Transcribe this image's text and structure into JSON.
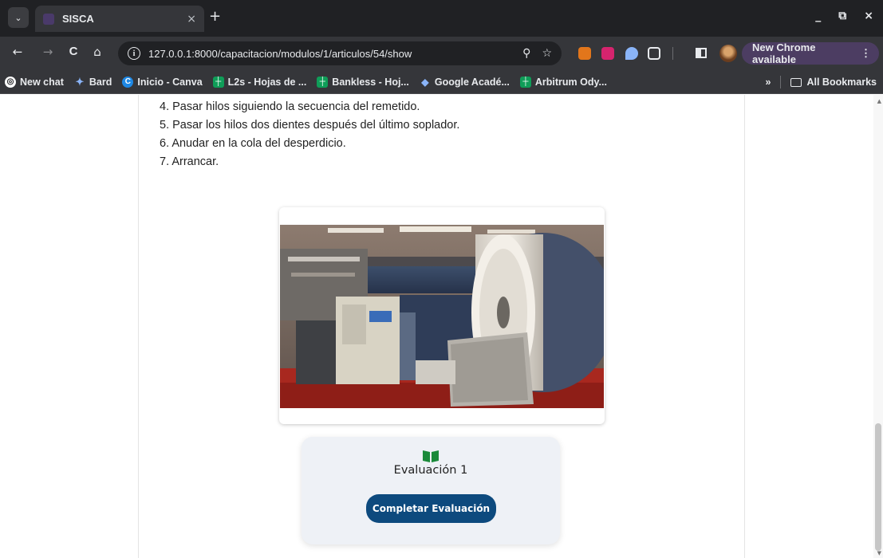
{
  "browser": {
    "tab": {
      "title": "SISCA",
      "close": "×",
      "new_tab": "+"
    },
    "window_controls": {
      "minimize": "_",
      "restore": "⧉",
      "close": "×"
    },
    "toolbar": {
      "back": "←",
      "forward": "→",
      "reload": "C",
      "home": "⌂",
      "url": "127.0.0.1:8000/capacitacion/modulos/1/articulos/54/show",
      "zoom": "⚲",
      "bookmark_star": "☆",
      "update_label": "New Chrome available",
      "menu_dots": "⋮"
    },
    "bookmarks": [
      {
        "label": "New chat",
        "icon": "openai-icon",
        "color": "#202124"
      },
      {
        "label": "Bard",
        "icon": "sparkle-icon",
        "color": "#4c8bf5"
      },
      {
        "label": "Inicio - Canva",
        "icon": "canva-icon",
        "color": "#1e88e5"
      },
      {
        "label": "L2s - Hojas de ...",
        "icon": "sheets-icon",
        "color": "#0f9d58"
      },
      {
        "label": "Bankless - Hoj...",
        "icon": "sheets-icon",
        "color": "#0f9d58"
      },
      {
        "label": "Google Acadé...",
        "icon": "scholar-icon",
        "color": "#4285f4"
      },
      {
        "label": "Arbitrum Ody...",
        "icon": "sheets-icon",
        "color": "#0f9d58"
      }
    ],
    "bookmarks_overflow": "»",
    "all_bookmarks": "All Bookmarks"
  },
  "article": {
    "steps": [
      "4. Pasar hilos siguiendo la secuencia del remetido.",
      "5. Pasar los hilos dos dientes después del último soplador.",
      "6. Anudar en la cola del desperdicio.",
      "7. Arrancar."
    ]
  },
  "evaluation": {
    "icon": "book-icon",
    "title": "Evaluación 1",
    "button_label": "Completar Evaluación"
  },
  "colors": {
    "accent_button": "#0d4a7e",
    "book_icon": "#1a8a3a",
    "chrome_dark": "#202124",
    "chrome_toolbar": "#35363a"
  }
}
